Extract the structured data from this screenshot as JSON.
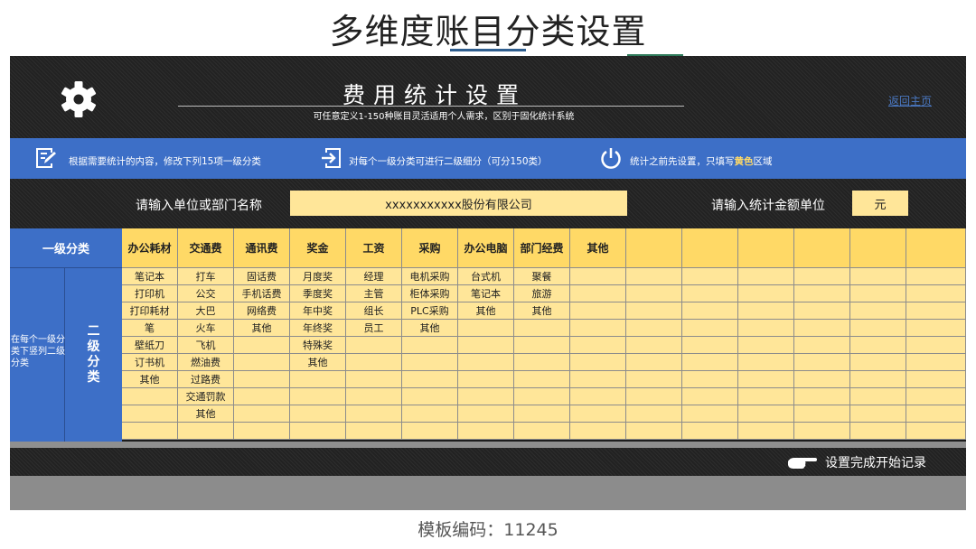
{
  "heading": "多维度账目分类设置",
  "settings": {
    "title": "费用统计设置",
    "subtitle": "可任意定义1-150种账目灵活适用个人需求，区别于固化统计系统",
    "back_link": "返回主页"
  },
  "info_bar": {
    "item1": "根据需要统计的内容，修改下列15项一级分类",
    "item2": "对每个一级分类可进行二级细分（可分150类）",
    "item3_pre": "统计之前先设置，只填写",
    "item3_hl": "黄色",
    "item3_post": "区域"
  },
  "form": {
    "company_label": "请输入单位或部门名称",
    "company_value": "xxxxxxxxxxx股份有限公司",
    "unit_label": "请输入统计金额单位",
    "unit_value": "元"
  },
  "table": {
    "level1_label": "一级分类",
    "level2_label": "二级分类",
    "side_note": "在每个一级分类下竖列二级分类",
    "categories": [
      {
        "name": "办公耗材",
        "subs": [
          "笔记本",
          "打印机",
          "打印耗材",
          "笔",
          "壁纸刀",
          "订书机",
          "其他"
        ]
      },
      {
        "name": "交通费",
        "subs": [
          "打车",
          "公交",
          "大巴",
          "火车",
          "飞机",
          "燃油费",
          "过路费",
          "交通罚款",
          "其他"
        ]
      },
      {
        "name": "通讯费",
        "subs": [
          "固话费",
          "手机话费",
          "网络费",
          "其他"
        ]
      },
      {
        "name": "奖金",
        "subs": [
          "月度奖",
          "季度奖",
          "年中奖",
          "年终奖",
          "特殊奖",
          "其他"
        ]
      },
      {
        "name": "工资",
        "subs": [
          "经理",
          "主管",
          "组长",
          "员工"
        ]
      },
      {
        "name": "采购",
        "subs": [
          "电机采购",
          "柜体采购",
          "PLC采购",
          "其他"
        ]
      },
      {
        "name": "办公电脑",
        "subs": [
          "台式机",
          "笔记本",
          "其他"
        ]
      },
      {
        "name": "部门经费",
        "subs": [
          "聚餐",
          "旅游",
          "其他"
        ]
      },
      {
        "name": "其他",
        "subs": []
      },
      {
        "name": "",
        "subs": []
      },
      {
        "name": "",
        "subs": []
      },
      {
        "name": "",
        "subs": []
      },
      {
        "name": "",
        "subs": []
      },
      {
        "name": "",
        "subs": []
      },
      {
        "name": "",
        "subs": []
      }
    ]
  },
  "finish_button": "设置完成开始记录",
  "template_code": "模板编码：11245",
  "colors": {
    "blue": "#3d6fc7",
    "yellow": "#ffd966",
    "light_yellow": "#ffe699",
    "dark": "#222222"
  },
  "icons": [
    "gear-icon",
    "edit-icon",
    "enter-icon",
    "power-icon",
    "pointing-hand-icon"
  ]
}
